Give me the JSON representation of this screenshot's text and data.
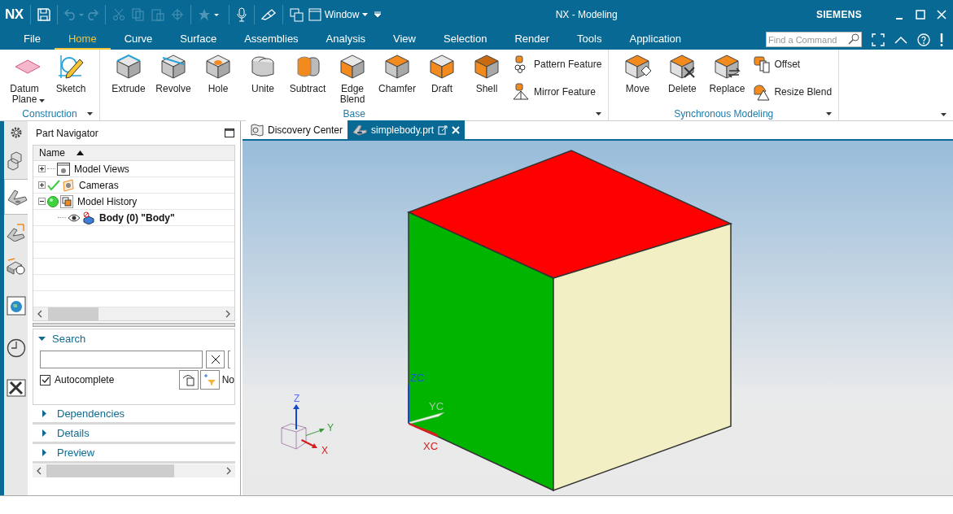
{
  "window": {
    "logo": "NX",
    "title": "NX - Modeling",
    "brand": "SIEMENS",
    "window_menu": "Window"
  },
  "menu_tabs": [
    {
      "label": "File",
      "selected": false
    },
    {
      "label": "Home",
      "selected": true
    },
    {
      "label": "Curve",
      "selected": false
    },
    {
      "label": "Surface",
      "selected": false
    },
    {
      "label": "Assemblies",
      "selected": false
    },
    {
      "label": "Analysis",
      "selected": false
    },
    {
      "label": "View",
      "selected": false
    },
    {
      "label": "Selection",
      "selected": false
    },
    {
      "label": "Render",
      "selected": false
    },
    {
      "label": "Tools",
      "selected": false
    },
    {
      "label": "Application",
      "selected": false
    }
  ],
  "command_search": {
    "placeholder": "Find a Command"
  },
  "ribbon_groups": [
    {
      "label": "Construction",
      "items": [
        {
          "kind": "large",
          "label": "Datum Plane",
          "dropdown": true
        },
        {
          "kind": "large",
          "label": "Sketch",
          "dropdown": false
        }
      ]
    },
    {
      "label": "Base",
      "items": [
        {
          "kind": "large",
          "label": "Extrude",
          "dropdown": false
        },
        {
          "kind": "large",
          "label": "Revolve",
          "dropdown": false
        },
        {
          "kind": "large",
          "label": "Hole",
          "dropdown": false
        },
        {
          "kind": "large",
          "label": "Unite",
          "dropdown": false
        },
        {
          "kind": "large",
          "label": "Subtract",
          "dropdown": false
        },
        {
          "kind": "large",
          "label": "Edge Blend",
          "dropdown": false
        },
        {
          "kind": "large",
          "label": "Chamfer",
          "dropdown": false
        },
        {
          "kind": "large",
          "label": "Draft",
          "dropdown": false
        },
        {
          "kind": "large",
          "label": "Shell",
          "dropdown": false
        },
        {
          "kind": "small",
          "label": "Pattern Feature",
          "dropdown": false
        },
        {
          "kind": "small",
          "label": "Mirror Feature",
          "dropdown": false
        }
      ]
    },
    {
      "label": "Synchronous Modeling",
      "items": [
        {
          "kind": "large",
          "label": "Move",
          "dropdown": false
        },
        {
          "kind": "large",
          "label": "Delete",
          "dropdown": false
        },
        {
          "kind": "large",
          "label": "Replace",
          "dropdown": false
        },
        {
          "kind": "small",
          "label": "Offset",
          "dropdown": false
        },
        {
          "kind": "small",
          "label": "Resize Blend",
          "dropdown": false
        }
      ]
    }
  ],
  "side_tabs": [
    {
      "selected": false
    },
    {
      "selected": false
    },
    {
      "selected": true
    },
    {
      "selected": false
    },
    {
      "selected": false
    },
    {
      "selected": false
    },
    {
      "selected": false
    },
    {
      "selected": false
    }
  ],
  "navigator": {
    "title": "Part Navigator",
    "column": "Name",
    "tree": [
      {
        "label": "Model Views",
        "expanded": false,
        "bold": false
      },
      {
        "label": "Cameras",
        "expanded": false,
        "bold": false
      },
      {
        "label": "Model History",
        "expanded": true,
        "bold": false,
        "children": [
          {
            "label": "Body (0) \"Body\"",
            "bold": true
          }
        ]
      }
    ],
    "search": {
      "label": "Search",
      "expanded": true,
      "autocomplete": {
        "label": "Autocomplete",
        "checked": true
      },
      "cut_label": "No"
    },
    "sections": [
      {
        "label": "Dependencies",
        "expanded": false
      },
      {
        "label": "Details",
        "expanded": false
      },
      {
        "label": "Preview",
        "expanded": false
      }
    ]
  },
  "doc_tabs": [
    {
      "label": "Discovery Center",
      "selected": false
    },
    {
      "label": "simplebody.prt",
      "selected": true
    }
  ],
  "view": {
    "triad": {
      "z": "Z",
      "y": "Y",
      "x": "X"
    },
    "wcs": {
      "z": "ZC",
      "y": "YC",
      "x": "XC"
    }
  }
}
